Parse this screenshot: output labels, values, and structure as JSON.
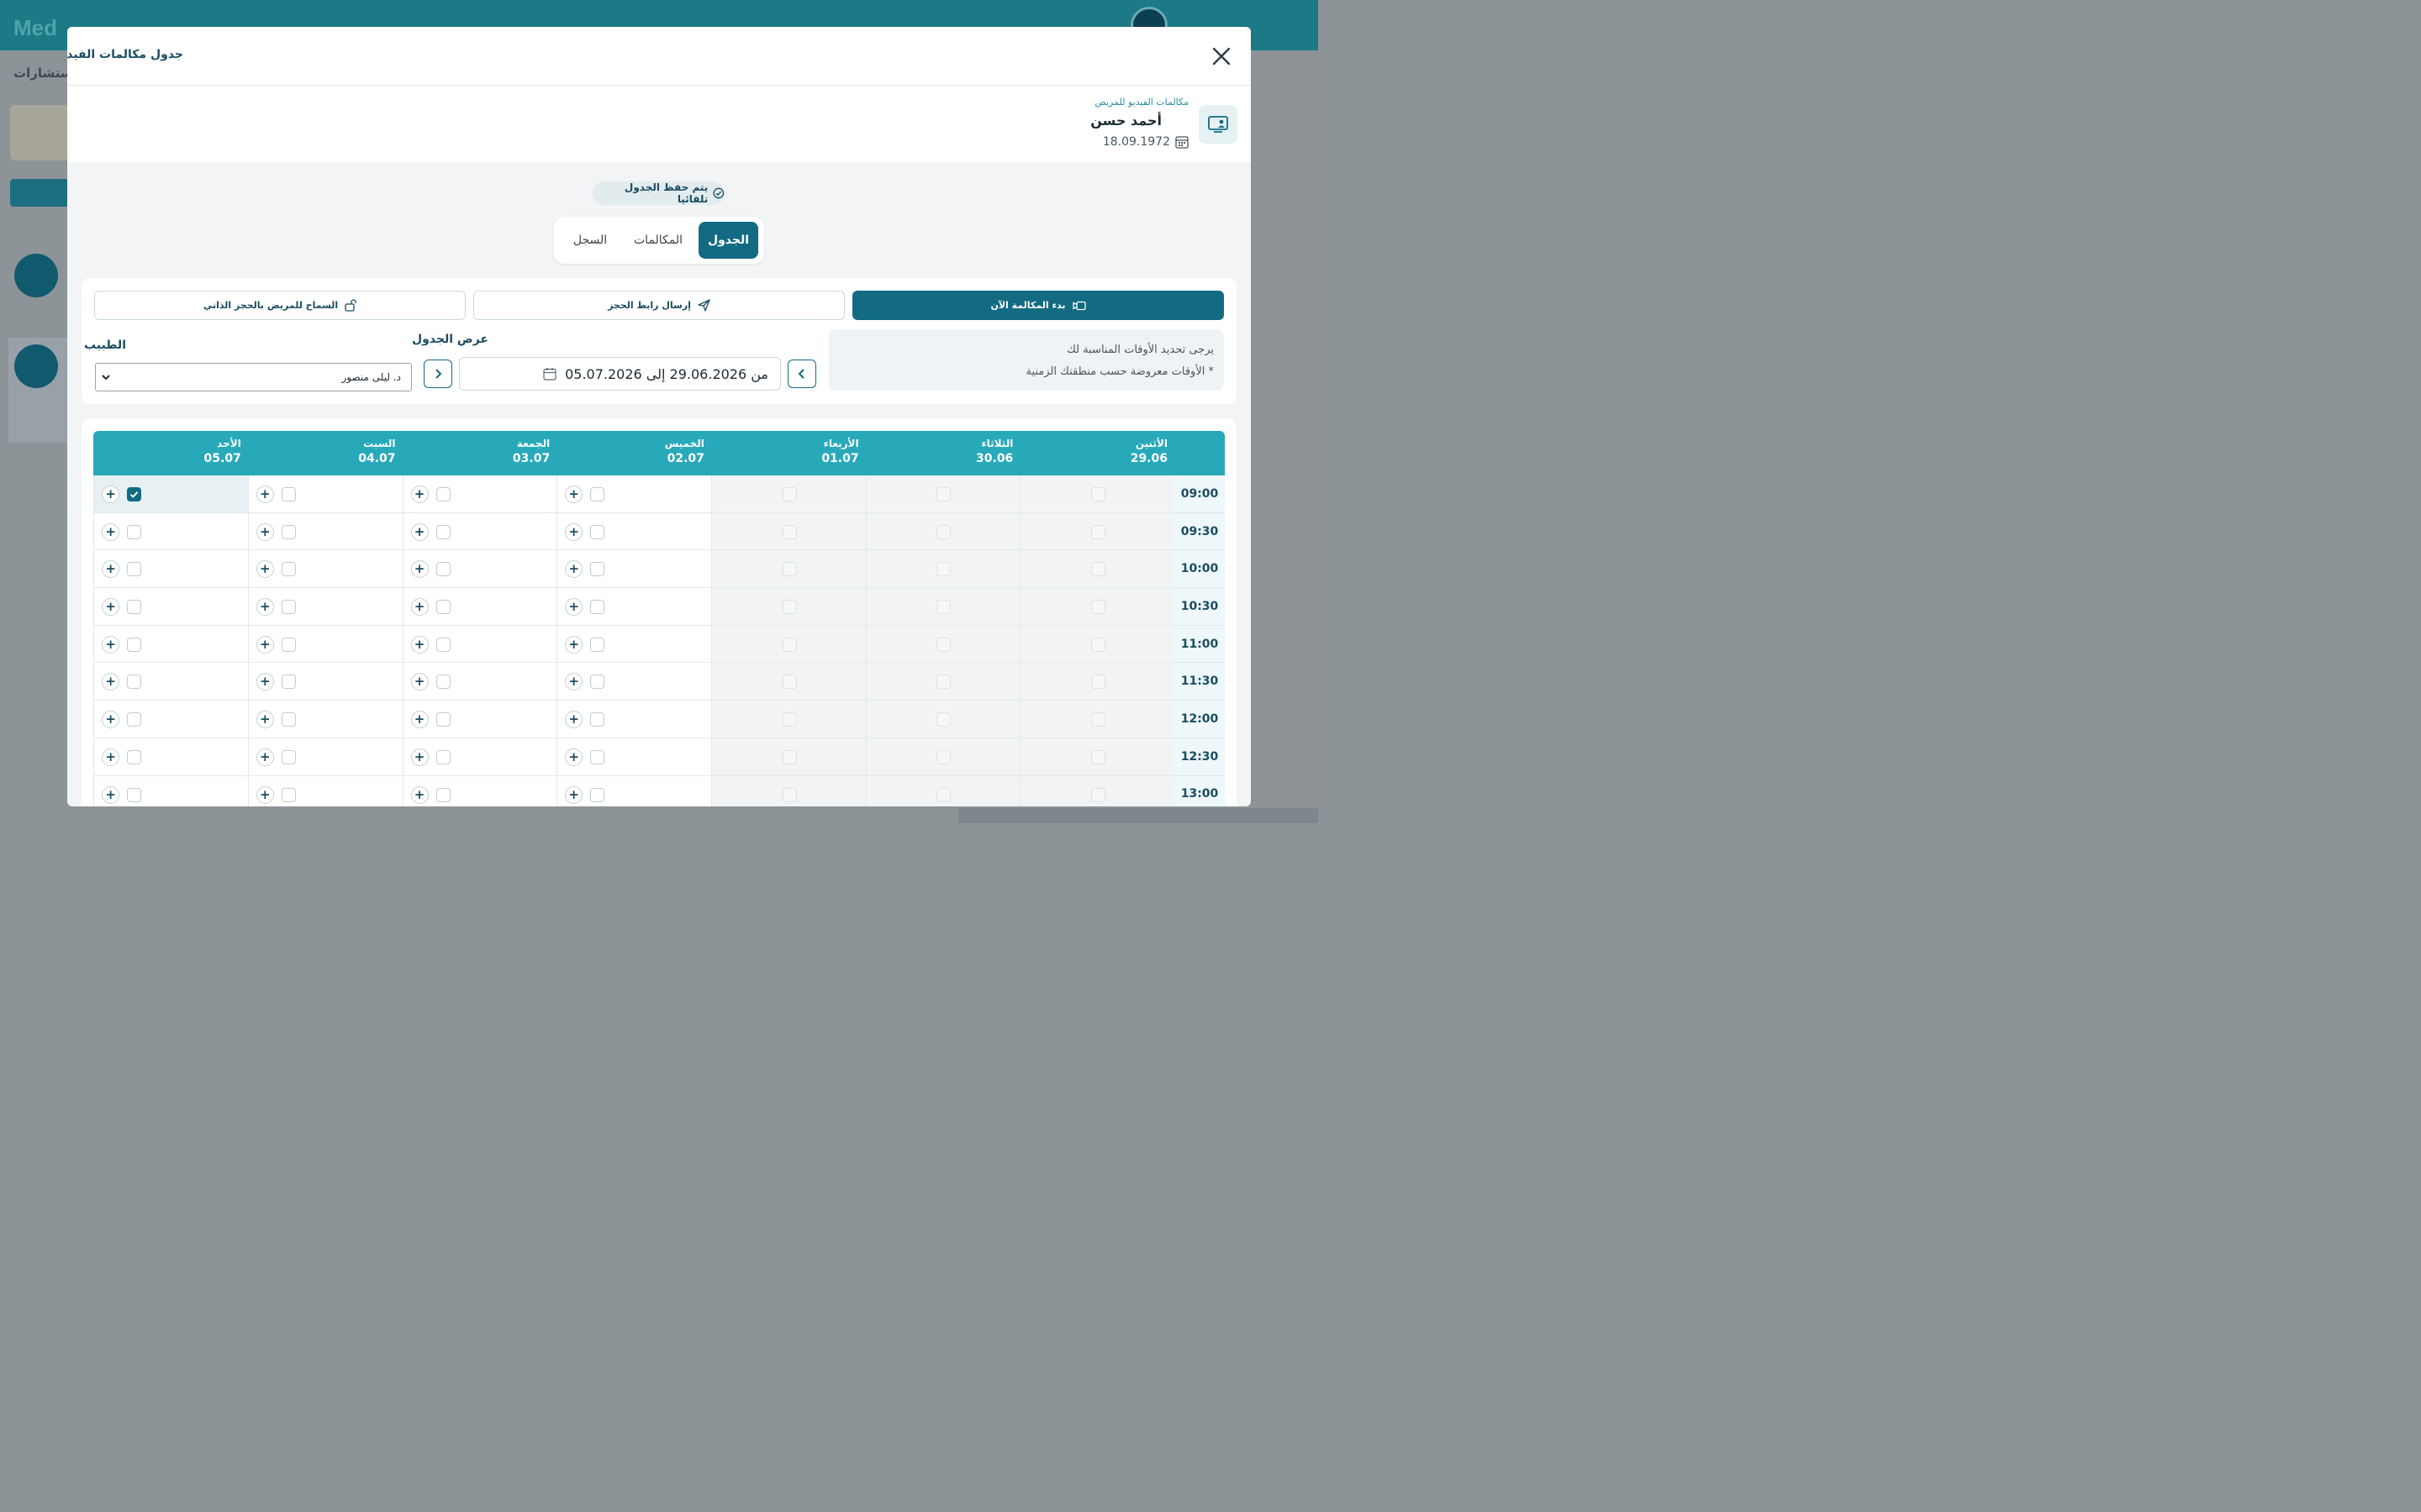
{
  "background": {
    "logo": "Med",
    "left_text": "سجلات الاستشارات"
  },
  "modal": {
    "title": "جدول مكالمات الفيديو"
  },
  "patient": {
    "caption": "مكالمات الفيديو للمريض",
    "name": "أحمد حسن",
    "dob": "18.09.1972"
  },
  "autosave_label": "يتم حفظ الجدول تلقائيا",
  "tabs": [
    {
      "label": "الجدول",
      "active": true
    },
    {
      "label": "المكالمات",
      "active": false
    },
    {
      "label": "السجل",
      "active": false
    }
  ],
  "actions": {
    "start_call": "بدء المكالمة الآن",
    "send_link": "إرسال رابط الحجز",
    "self_booking": "السماح للمريض بالحجز الذاتي"
  },
  "info": {
    "line1": "يرجى تحديد الأوقات المناسبة لك",
    "line2": "* الأوقات معروضة حسب منطقتك الزمنية"
  },
  "schedule_view_label": "عرض الجدول",
  "date_range": "من 29.06.2026 إلى 05.07.2026",
  "doctor_label": "الطبيب",
  "doctor_selected": "د. ليلى منصور",
  "colors": {
    "primary": "#136a83",
    "header_teal": "#28a9ba",
    "modal_title": "#1b4d62"
  },
  "days": [
    {
      "name": "الأثنين",
      "date": "29.06",
      "past": true
    },
    {
      "name": "الثلاثاء",
      "date": "30.06",
      "past": true
    },
    {
      "name": "الأربعاء",
      "date": "01.07",
      "past": true
    },
    {
      "name": "الخميس",
      "date": "02.07",
      "past": false
    },
    {
      "name": "الجمعة",
      "date": "03.07",
      "past": false
    },
    {
      "name": "السبت",
      "date": "04.07",
      "past": false
    },
    {
      "name": "الأحد",
      "date": "05.07",
      "past": false
    }
  ],
  "times": [
    "09:00",
    "09:30",
    "10:00",
    "10:30",
    "11:00",
    "11:30",
    "12:00",
    "12:30",
    "13:00"
  ],
  "checked_slots": [
    {
      "day": "05.07",
      "time": "09:00"
    }
  ],
  "plus_symbol": "+"
}
